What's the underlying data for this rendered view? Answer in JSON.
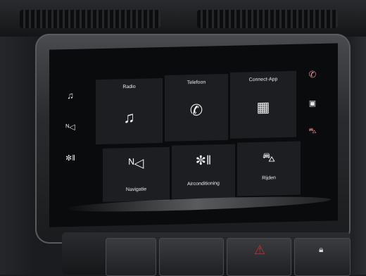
{
  "tiles": {
    "radio": {
      "label": "Radio",
      "icon": "music-note-icon"
    },
    "telefoon": {
      "label": "Telefoon",
      "icon": "phone-icon"
    },
    "connect_app": {
      "label": "Connect-App",
      "icon": "grid-icon"
    },
    "navigatie": {
      "label": "Navigatie",
      "icon": "navigation-icon"
    },
    "airconditioning": {
      "label": "Airconditioning",
      "icon": "fan-icon"
    },
    "rijden": {
      "label": "Rijden",
      "icon": "car-icon"
    }
  },
  "left_rail": [
    {
      "icon": "music-note-icon"
    },
    {
      "icon": "navigation-icon"
    },
    {
      "icon": "fan-icon"
    }
  ],
  "right_rail": [
    {
      "icon": "phone-icon"
    },
    {
      "icon": "grid-icon"
    },
    {
      "icon": "car-icon"
    }
  ],
  "colors": {
    "tile_bg": "#1c1e22",
    "accent_icon": "#e98b8b",
    "hazard": "#d12a2a"
  }
}
